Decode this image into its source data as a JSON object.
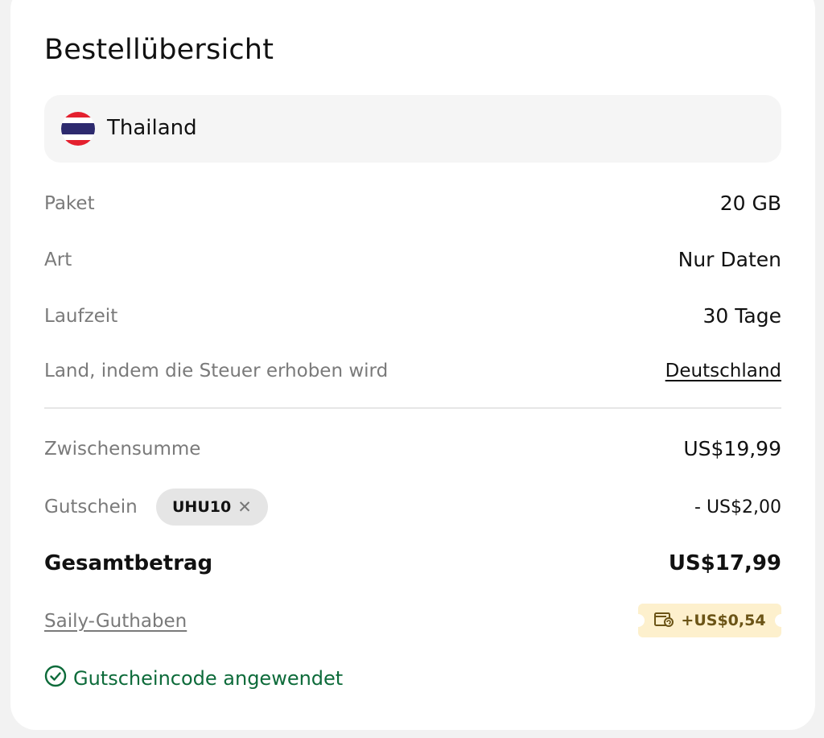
{
  "header": {
    "title": "Bestellübersicht"
  },
  "destination": {
    "country": "Thailand",
    "flag_icon": "thailand-flag-icon"
  },
  "details": {
    "package_label": "Paket",
    "package_value": "20 GB",
    "type_label": "Art",
    "type_value": "Nur Daten",
    "duration_label": "Laufzeit",
    "duration_value": "30 Tage",
    "tax_country_label": "Land, indem die Steuer erhoben wird",
    "tax_country_value": "Deutschland"
  },
  "pricing": {
    "subtotal_label": "Zwischensumme",
    "subtotal_value": "US$19,99",
    "coupon_label": "Gutschein",
    "coupon_code": "UHU10",
    "coupon_remove_glyph": "✕",
    "discount_value": "- US$2,00",
    "total_label": "Gesamtbetrag",
    "total_value": "US$17,99",
    "credit_label": "Saily-Guthaben",
    "credit_value": "+US$0,54",
    "credit_icon": "wallet-refresh-icon"
  },
  "status": {
    "message": "Gutscheincode angewendet",
    "icon": "check-circle-icon"
  },
  "colors": {
    "success": "#0d6b3a",
    "credit_bg": "#fdf0cd",
    "credit_text": "#6b5416",
    "chip_bg": "#e5e5e5",
    "muted_text": "#7a7a7a"
  }
}
